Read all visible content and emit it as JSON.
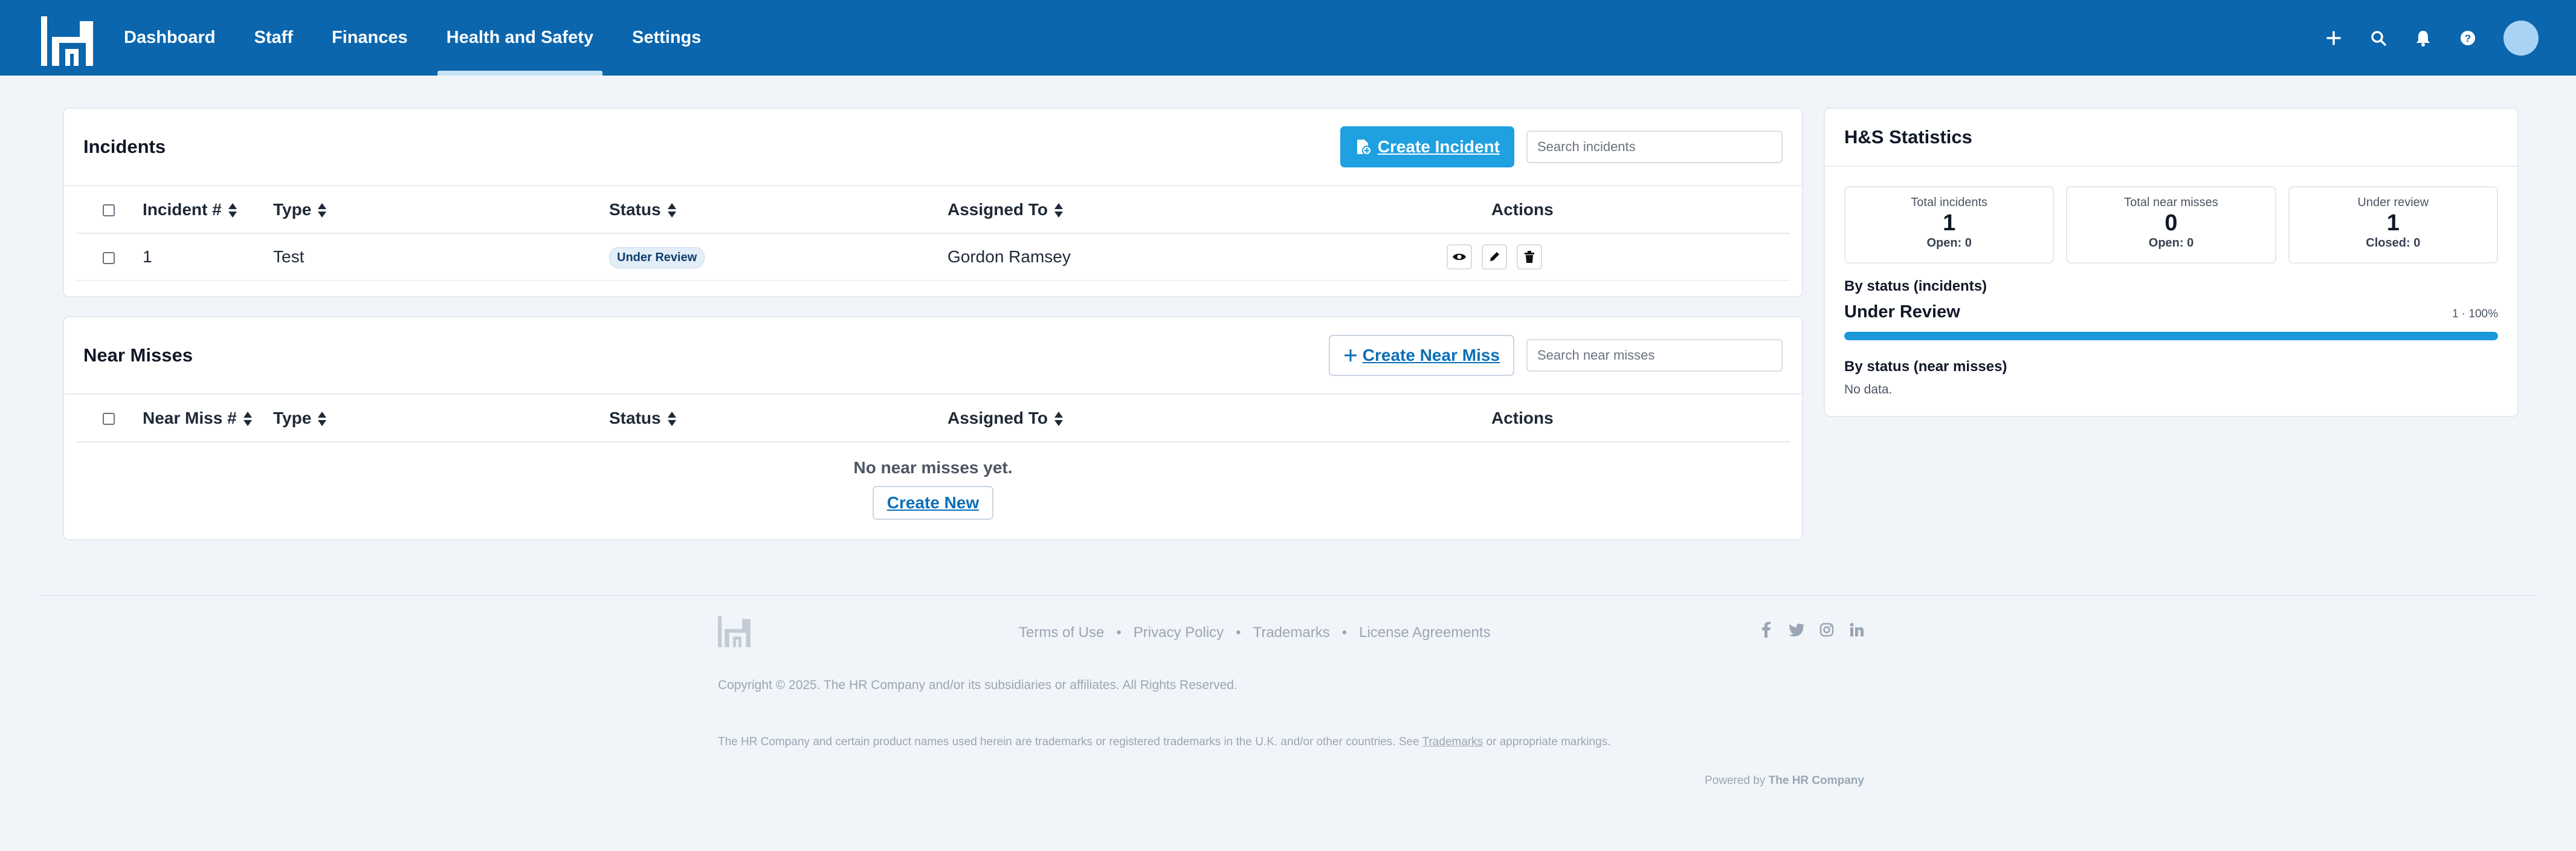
{
  "nav": {
    "items": [
      {
        "label": "Dashboard"
      },
      {
        "label": "Staff"
      },
      {
        "label": "Finances"
      },
      {
        "label": "Health and Safety"
      },
      {
        "label": "Settings"
      }
    ],
    "active_index": 3
  },
  "incidents": {
    "title": "Incidents",
    "create_label": "Create Incident",
    "search_placeholder": "Search incidents",
    "columns": [
      "Incident #",
      "Type",
      "Status",
      "Assigned To",
      "Actions"
    ],
    "rows": [
      {
        "number": "1",
        "type": "Test",
        "status": "Under Review",
        "assigned_to": "Gordon Ramsey"
      }
    ]
  },
  "near_misses": {
    "title": "Near Misses",
    "create_label": "Create Near Miss",
    "search_placeholder": "Search near misses",
    "columns": [
      "Near Miss #",
      "Type",
      "Status",
      "Assigned To",
      "Actions"
    ],
    "empty_text": "No near misses yet.",
    "empty_button": "Create New"
  },
  "stats": {
    "title": "H&S Statistics",
    "boxes": [
      {
        "label": "Total incidents",
        "value": "1",
        "sub": "Open: 0"
      },
      {
        "label": "Total near misses",
        "value": "0",
        "sub": "Open: 0"
      },
      {
        "label": "Under review",
        "value": "1",
        "sub": "Closed: 0"
      }
    ],
    "by_status_incidents_label": "By status (incidents)",
    "incident_status": {
      "name": "Under Review",
      "count_pct": "1 · 100%",
      "fraction": 1.0
    },
    "by_status_near_misses_label": "By status (near misses)",
    "near_miss_empty": "No data."
  },
  "footer": {
    "links": [
      "Terms of Use",
      "Privacy Policy",
      "Trademarks",
      "License Agreements"
    ],
    "separator": "•",
    "copyright": "Copyright © 2025. The HR Company and/or its subsidiaries or affiliates. All Rights Reserved.",
    "trademark_note_pre": "The HR Company and certain product names used herein are trademarks or registered trademarks in the U.K. and/or other countries. See",
    "trademark_link": "Trademarks",
    "trademark_note_post": "or appropriate markings.",
    "powered_by": "Powered by",
    "powered_company": "The HR Company"
  },
  "colors": {
    "brand": "#0b66ad",
    "primary_button": "#1fa0e0",
    "progress": "#1b98da"
  }
}
